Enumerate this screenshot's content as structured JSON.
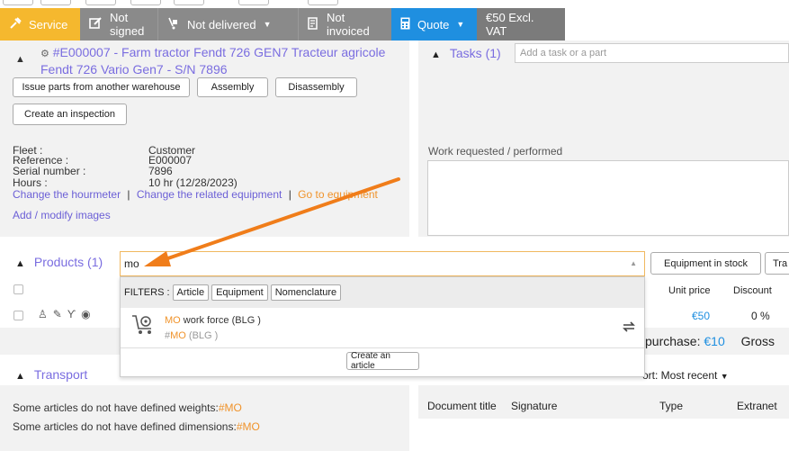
{
  "status_bar": {
    "service": "Service",
    "not_signed": "Not signed",
    "not_delivered": "Not delivered",
    "not_invoiced": "Not invoiced",
    "quote": "Quote",
    "amount": "€50 Excl. VAT"
  },
  "equipment": {
    "title": "#E000007 - Farm tractor Fendt 726 GEN7 Tracteur agricole Fendt 726 Vario Gen7 - S/N 7896",
    "buttons": {
      "issue_parts": "Issue parts from another warehouse",
      "assembly": "Assembly",
      "disassembly": "Disassembly",
      "create_inspection": "Create an inspection"
    },
    "fields": [
      {
        "label": "Fleet :",
        "value": "Customer"
      },
      {
        "label": "Reference :",
        "value": "E000007"
      },
      {
        "label": "Serial number :",
        "value": "7896"
      },
      {
        "label": "Hours :",
        "value": "10 hr (12/28/2023)"
      }
    ],
    "links": {
      "change_hourmeter": "Change the hourmeter",
      "sep": "|",
      "change_related": "Change the related equipment",
      "go_to_equipment": "Go to equipment",
      "add_images": "Add / modify images"
    }
  },
  "tasks": {
    "title": "Tasks (1)",
    "placeholder": "Add a task or a part",
    "work_requested_label": "Work requested / performed"
  },
  "products": {
    "title": "Products (1)",
    "search_value": "mo",
    "equipment_in_stock": "Equipment in stock",
    "tra": "Tra",
    "col_unit_price": "Unit price",
    "col_discount": "Discount",
    "row_price": "€50",
    "row_discount": "0 %",
    "purchase_label": "purchase:",
    "purchase_value": "€10",
    "gross": "Gross"
  },
  "dropdown": {
    "filters_label": "FILTERS :",
    "filters": [
      "Article",
      "Equipment",
      "Nomenclature"
    ],
    "result_highlight": "MO",
    "result_rest": " work force (BLG )",
    "result_sub_prefix": "#",
    "result_sub_highlight": "MO",
    "result_sub_rest": " (BLG )",
    "create_article": "Create an article"
  },
  "transport": {
    "title": "Transport",
    "line1_text": "Some articles do not have defined weights:",
    "line1_code": "#MO",
    "line2_text": "Some articles do not have defined dimensions:",
    "line2_code": "#MO"
  },
  "documents": {
    "sort_label": "ort: Most recent",
    "col_title": "Document title",
    "col_signature": "Signature",
    "col_type": "Type",
    "col_extranet": "Extranet"
  },
  "colors": {
    "service": "#f5b82e",
    "status_gray": "#8a8a8a",
    "quote_blue": "#1f8fe0",
    "link": "#6b5fd6",
    "highlight": "#f0932b",
    "arrow": "#f07d1a"
  }
}
